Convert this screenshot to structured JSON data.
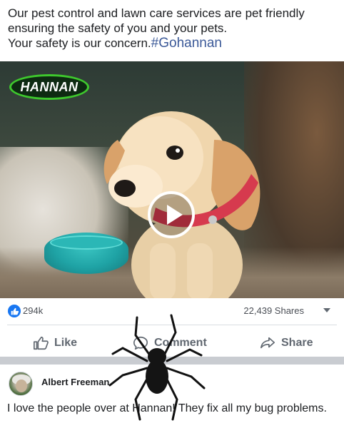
{
  "post": {
    "caption_line1": "Our pest control and lawn care services are pet friendly",
    "caption_line2": "ensuring the safety of you and your pets.",
    "caption_line3": "Your safety is our concern.",
    "hashtag": "#Gohannan"
  },
  "media": {
    "logo_text": "HANNAN",
    "play_icon": "play-circle-icon"
  },
  "stats": {
    "like_count": "294k",
    "shares": "22,439 Shares",
    "like_badge_icon": "thumbs-up-icon",
    "menu_icon": "caret-down-icon"
  },
  "actions": {
    "like_label": "Like",
    "comment_label": "Comment",
    "share_label": "Share"
  },
  "comment": {
    "author": "Albert Freeman",
    "text": "I love the people over at Hannan! They fix all my bug problems."
  },
  "colors": {
    "brand_blue": "#1877f2",
    "hashtag_blue": "#3b5998",
    "logo_green": "#3ec82d",
    "bowl_teal": "#1fa3a5"
  }
}
